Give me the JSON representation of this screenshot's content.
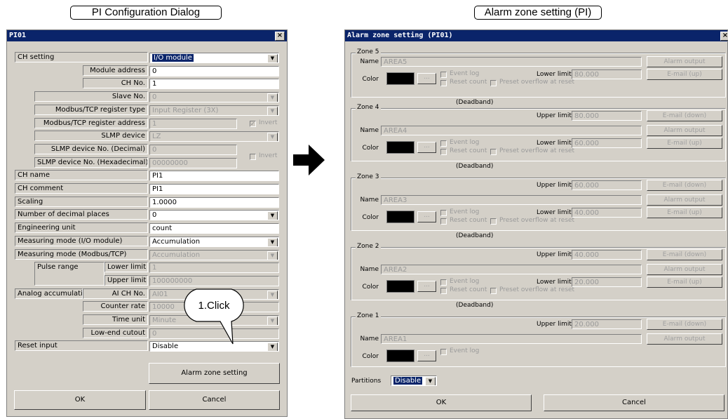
{
  "captions": {
    "left": "PI Configuration Dialog",
    "right": "Alarm zone setting (PI)"
  },
  "left_window": {
    "title": "PI01",
    "close_glyph": "×",
    "rows": {
      "ch_setting": {
        "label": "CH setting",
        "value": "I/O module"
      },
      "module_address": {
        "label": "Module address",
        "value": "0"
      },
      "ch_no": {
        "label": "CH No.",
        "value": "1"
      },
      "slave_no": {
        "label": "Slave No.",
        "value": "0"
      },
      "modbus_reg_type": {
        "label": "Modbus/TCP register type",
        "value": "Input Register (3X)"
      },
      "modbus_reg_addr": {
        "label": "Modbus/TCP register address",
        "value": "1",
        "invert": "Invert"
      },
      "slmp_device": {
        "label": "SLMP device",
        "value": "LZ"
      },
      "slmp_dev_dec": {
        "label": "SLMP device No. (Decimal)",
        "value": "0",
        "invert": "Invert"
      },
      "slmp_dev_hex": {
        "label": "SLMP device No. (Hexadecimal)",
        "value": "00000000"
      },
      "ch_name": {
        "label": "CH name",
        "value": "PI1"
      },
      "ch_comment": {
        "label": "CH comment",
        "value": "PI1"
      },
      "scaling": {
        "label": "Scaling",
        "value": "1.0000"
      },
      "decimal_places": {
        "label": "Number of decimal places",
        "value": "0"
      },
      "eng_unit": {
        "label": "Engineering unit",
        "value": "count"
      },
      "mode_io": {
        "label": "Measuring mode (I/O module)",
        "value": "Accumulation"
      },
      "mode_modbus": {
        "label": "Measuring mode (Modbus/TCP)",
        "value": "Accumulation"
      },
      "pulse_range": {
        "label": "Pulse range",
        "lower_label": "Lower limit",
        "lower": "1",
        "upper_label": "Upper limit",
        "upper": "100000000"
      },
      "analog_acc": {
        "label": "Analog accumulation",
        "ai_label": "AI CH No.",
        "ai": "AI01"
      },
      "counter_rate": {
        "label": "Counter rate",
        "value": "10000"
      },
      "time_unit": {
        "label": "Time unit",
        "value": "Minute"
      },
      "low_cutout": {
        "label": "Low-end cutout",
        "value": "0"
      },
      "reset_input": {
        "label": "Reset input",
        "value": "Disable"
      }
    },
    "alarm_zone_button": "Alarm zone setting",
    "ok": "OK",
    "cancel": "Cancel",
    "callout": "1.Click"
  },
  "right_window": {
    "title": "Alarm zone setting (PI01)",
    "close_glyph": "×",
    "labels": {
      "name": "Name",
      "color": "Color",
      "upper": "Upper limit",
      "lower": "Lower limit",
      "event_log": "Event log",
      "reset_count": "Reset count",
      "preset_overflow": "Preset overflow at reset",
      "deadband": "(Deadband)",
      "alarm_output": "Alarm output",
      "email_up": "E-mail (up)",
      "email_down": "E-mail (down)",
      "ellipsis": "..."
    },
    "zones": [
      {
        "title": "Zone 5",
        "name": "AREA5",
        "upper": null,
        "lower": "80.000"
      },
      {
        "title": "Zone 4",
        "name": "AREA4",
        "upper": "80.000",
        "lower": "60.000"
      },
      {
        "title": "Zone 3",
        "name": "AREA3",
        "upper": "60.000",
        "lower": "40.000"
      },
      {
        "title": "Zone 2",
        "name": "AREA2",
        "upper": "40.000",
        "lower": "20.000"
      },
      {
        "title": "Zone 1",
        "name": "AREA1",
        "upper": "20.000",
        "lower": null
      }
    ],
    "partitions_label": "Partitions",
    "partitions_value": "Disable",
    "ok": "OK",
    "cancel": "Cancel"
  },
  "colors": {
    "title_bar": "#0a246a",
    "dialog_bg": "#d4d0c8",
    "swatch": "#000000"
  }
}
